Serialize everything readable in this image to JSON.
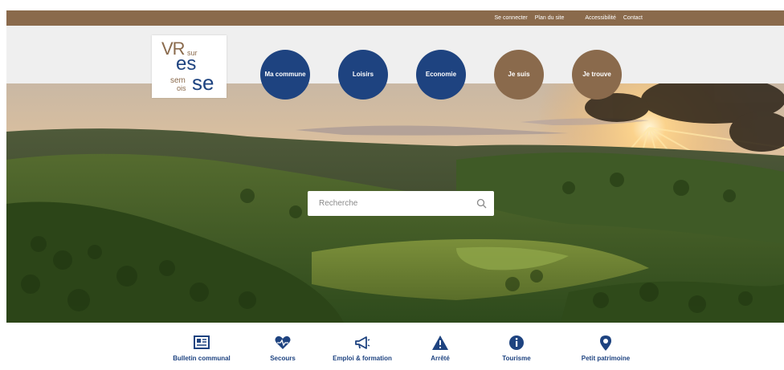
{
  "topbar": {
    "links": [
      "Se connecter",
      "Plan du site",
      "Accessibilité",
      "Contact"
    ]
  },
  "logo": {
    "line1": "VR",
    "line1_small": "sur",
    "line2": "es",
    "line3a": "sem",
    "line3b": "ois",
    "line3c": "se"
  },
  "nav": [
    {
      "label": "Ma commune",
      "color": "#1e4380"
    },
    {
      "label": "Loisirs",
      "color": "#1e4380"
    },
    {
      "label": "Economie",
      "color": "#1e4380"
    },
    {
      "label": "Je suis",
      "color": "#8a6a4c"
    },
    {
      "label": "Je trouve",
      "color": "#8a6a4c"
    }
  ],
  "search": {
    "placeholder": "Recherche",
    "icon": "magnifier-icon"
  },
  "quick_links": [
    {
      "label": "Bulletin communal",
      "icon": "newspaper-icon"
    },
    {
      "label": "Secours",
      "icon": "heart-pulse-icon"
    },
    {
      "label": "Emploi & formation",
      "icon": "megaphone-icon"
    },
    {
      "label": "Arrêté",
      "icon": "warning-icon"
    },
    {
      "label": "Tourisme",
      "icon": "info-icon"
    },
    {
      "label": "Petit patrimoine",
      "icon": "map-pin-icon"
    }
  ],
  "colors": {
    "brand_blue": "#1e4380",
    "brand_brown": "#8a6a4c"
  }
}
